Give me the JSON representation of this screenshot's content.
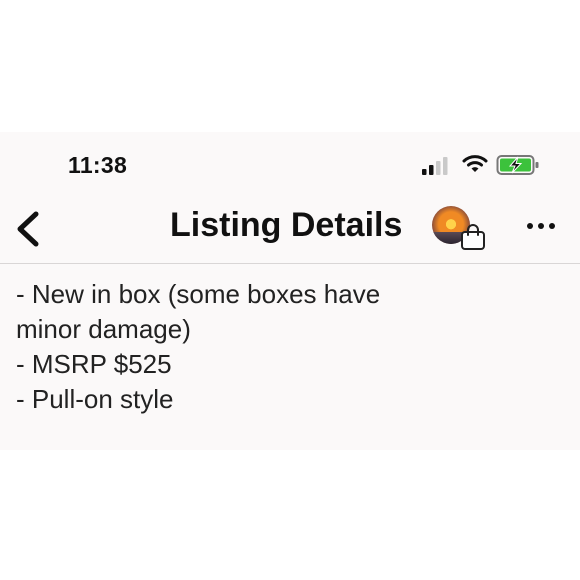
{
  "status_bar": {
    "time": "11:38",
    "icons": [
      "signal-icon",
      "wifi-icon",
      "battery-charging-icon"
    ],
    "battery_color": "#3cc23c"
  },
  "nav": {
    "title": "Listing Details",
    "back_icon": "chevron-left-icon",
    "more_icon": "ellipsis-icon",
    "shop_icon": "shopping-bag-icon"
  },
  "description": {
    "lines": [
      "- New in box (some boxes have",
      "minor damage)",
      "- MSRP $525",
      "- Pull-on style"
    ]
  }
}
